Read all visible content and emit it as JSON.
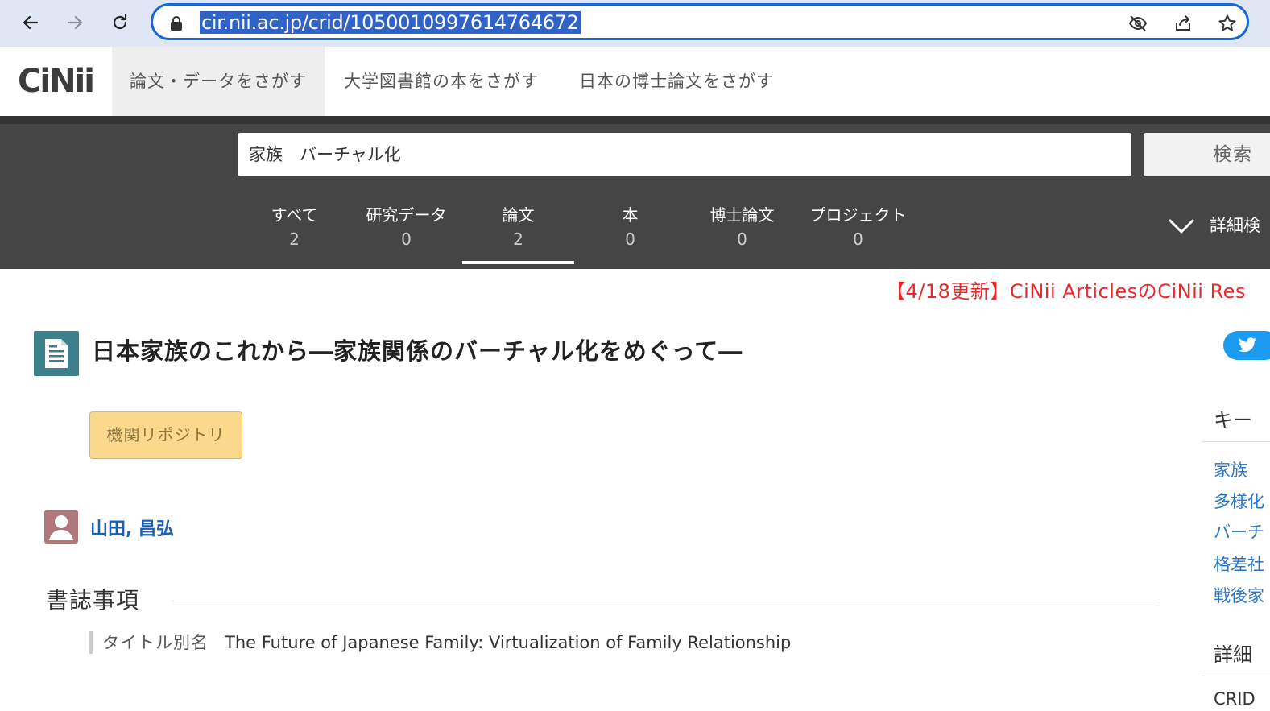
{
  "browser": {
    "url": "cir.nii.ac.jp/crid/1050010997614764672"
  },
  "site": {
    "logo": "CiNii",
    "service_tabs": [
      {
        "label": "論文・データをさがす",
        "active": true
      },
      {
        "label": "大学図書館の本をさがす",
        "active": false
      },
      {
        "label": "日本の博士論文をさがす",
        "active": false
      }
    ]
  },
  "search": {
    "query": "家族　バーチャル化",
    "button_label": "検索",
    "advanced_label": "詳細検"
  },
  "categories": [
    {
      "label": "すべて",
      "count": "2"
    },
    {
      "label": "研究データ",
      "count": "0"
    },
    {
      "label": "論文",
      "count": "2",
      "active": true
    },
    {
      "label": "本",
      "count": "0"
    },
    {
      "label": "博士論文",
      "count": "0"
    },
    {
      "label": "プロジェクト",
      "count": "0"
    }
  ],
  "notice": "【4/18更新】CiNii ArticlesのCiNii Res",
  "article": {
    "title": "日本家族のこれから―家族関係のバーチャル化をめぐって―",
    "badge": "機関リポジトリ",
    "author": "山田, 昌弘",
    "section_title": "書誌事項",
    "alt_title_key": "タイトル別名",
    "alt_title_value": "The Future of Japanese Family: Virtualization of Family Relationship"
  },
  "sidebar": {
    "keywords_heading": "キー",
    "keywords": [
      "家族",
      "多様化",
      "バーチ",
      "格差社",
      "戦後家"
    ],
    "details_heading": "詳細",
    "crid_label": "CRID"
  },
  "colors": {
    "accent_blue": "#1a66d2",
    "band": "#454545",
    "notice_red": "#e8292c",
    "badge_bg": "#fbd98c",
    "link": "#1c5fb0"
  }
}
